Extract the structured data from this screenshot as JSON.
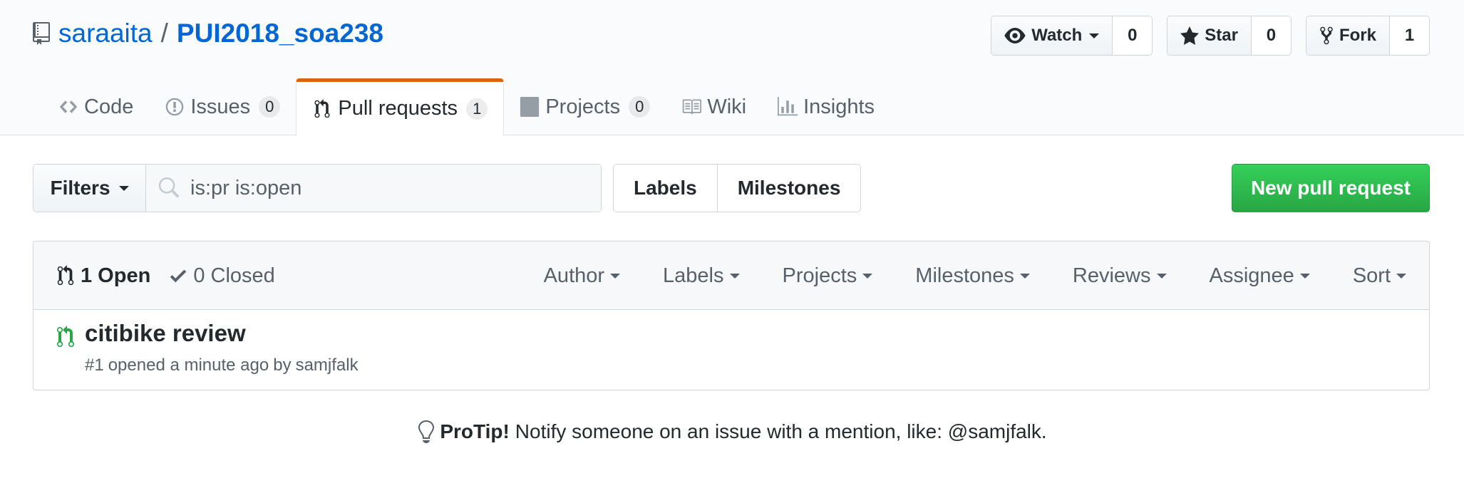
{
  "repo": {
    "owner": "saraaita",
    "separator": "/",
    "name": "PUI2018_soa238"
  },
  "actions": {
    "watch": {
      "label": "Watch",
      "count": "0"
    },
    "star": {
      "label": "Star",
      "count": "0"
    },
    "fork": {
      "label": "Fork",
      "count": "1"
    }
  },
  "nav": {
    "code": {
      "label": "Code"
    },
    "issues": {
      "label": "Issues",
      "count": "0"
    },
    "pull_requests": {
      "label": "Pull requests",
      "count": "1"
    },
    "projects": {
      "label": "Projects",
      "count": "0"
    },
    "wiki": {
      "label": "Wiki"
    },
    "insights": {
      "label": "Insights"
    }
  },
  "toolbar": {
    "filters_label": "Filters",
    "search_value": "is:pr is:open",
    "labels_label": "Labels",
    "milestones_label": "Milestones",
    "new_pr_label": "New pull request"
  },
  "list": {
    "open_label": "1 Open",
    "closed_label": "0 Closed",
    "menus": {
      "author": "Author",
      "labels": "Labels",
      "projects": "Projects",
      "milestones": "Milestones",
      "reviews": "Reviews",
      "assignee": "Assignee",
      "sort": "Sort"
    },
    "items": [
      {
        "title": "citibike review",
        "number": "#1",
        "opened": "opened a minute ago",
        "by": "by",
        "author": "samjfalk"
      }
    ]
  },
  "protip": {
    "label": "ProTip!",
    "text": "Notify someone on an issue with a mention, like: @samjfalk."
  },
  "colors": {
    "link": "#0366d6",
    "selected_tab_accent": "#e36209",
    "primary_button": "#28a745",
    "open_pr_icon": "#28a745"
  }
}
